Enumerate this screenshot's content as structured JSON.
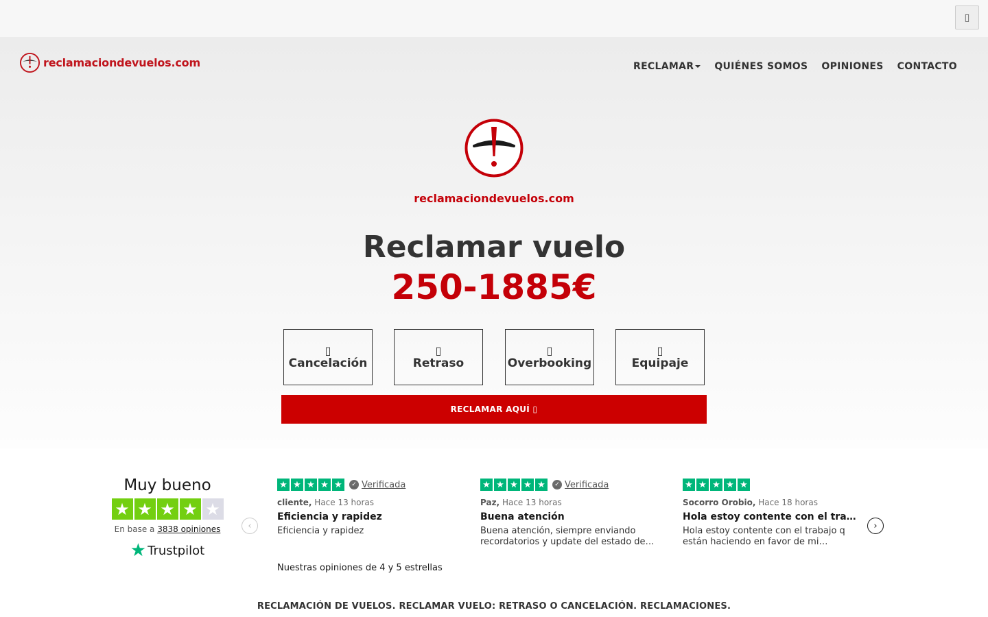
{
  "topbar": {
    "menu_icon": "square-icon",
    "menu_glyph": "▯"
  },
  "brand": {
    "name": "reclamaciondevuelos.com"
  },
  "nav": {
    "items": [
      {
        "label": "RECLAMAR",
        "has_dropdown": true
      },
      {
        "label": "QUIÉNES SOMOS"
      },
      {
        "label": "OPINIONES"
      },
      {
        "label": "CONTACTO"
      }
    ]
  },
  "hero": {
    "brand_name": "reclamaciondevuelos.com",
    "title": "Reclamar vuelo",
    "amount": "250-1885€",
    "options": [
      {
        "label": "Cancelación",
        "icon": "missing-glyph-icon",
        "glyph": "▯"
      },
      {
        "label": "Retraso",
        "icon": "missing-glyph-icon",
        "glyph": "▯"
      },
      {
        "label": "Overbooking",
        "icon": "missing-glyph-icon",
        "glyph": "▯"
      },
      {
        "label": "Equipaje",
        "icon": "missing-glyph-icon",
        "glyph": "▯"
      }
    ],
    "cta_label": "RECLAMAR AQUÍ ▯"
  },
  "trustpilot": {
    "rating_word": "Muy bueno",
    "stars_filled": 4,
    "stars_total": 5,
    "based_on_prefix": "En base a",
    "review_count_label": "3838 opiniones",
    "logo_text": "Trustpilot",
    "verified_label": "Verificada",
    "reviews": [
      {
        "stars": 5,
        "verified": true,
        "author": "cliente,",
        "time": "Hace 13 horas",
        "title": "Eficiencia y rapidez",
        "body": "Eficiencia y rapidez"
      },
      {
        "stars": 5,
        "verified": true,
        "author": "Paz,",
        "time": "Hace 13 horas",
        "title": "Buena atención",
        "body": "Buena atención, siempre enviando recordatorios y update del estado de…"
      },
      {
        "stars": 5,
        "verified": false,
        "author": "Socorro Orobio,",
        "time": "Hace 18 horas",
        "title": "Hola estoy contente con el tra…",
        "body": "Hola estoy contente con el trabajo q están haciendo en favor de mi…"
      }
    ],
    "note": "Nuestras opiniones de 4 y 5 estrellas",
    "colors": {
      "green": "#00b67a",
      "lime": "#73cf11",
      "grey": "#dcdce6"
    }
  },
  "footer": {
    "seo_title": "RECLAMACIÓN DE VUELOS. RECLAMAR VUELO: RETRASO O CANCELACIÓN. RECLAMACIONES."
  },
  "colors": {
    "brand_red": "#c40008",
    "cta_red": "#cc0000",
    "text_dark": "#333333"
  }
}
